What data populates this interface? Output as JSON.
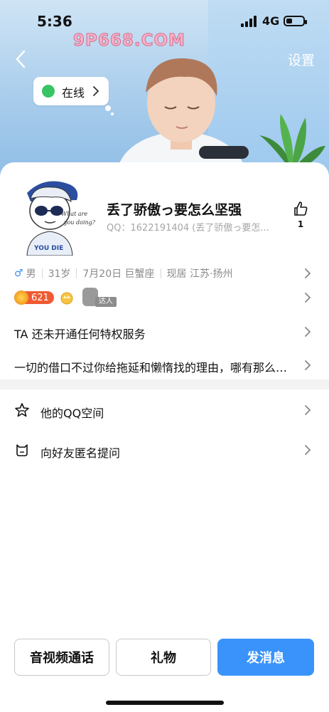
{
  "status_bar": {
    "time": "5:36",
    "network": "4G"
  },
  "header": {
    "watermark": "9P668.COM",
    "settings_label": "设置",
    "online_status": "在线"
  },
  "profile": {
    "nickname": "丢了骄傲っ要怎么坚强",
    "qq_line": "QQ：1622191404 (丢了骄傲っ要怎...",
    "like_count": "1",
    "gender": "男",
    "age": "31岁",
    "birthday": "7月20日 巨蟹座",
    "location": "现居 江苏·扬州",
    "level": "621",
    "talent_tag": "达人"
  },
  "lines": {
    "privilege": "TA 还未开通任何特权服务",
    "signature": "一切的借口不过你给拖延和懒惰找的理由，哪有那么多的借口"
  },
  "menu": {
    "qzone": "他的QQ空间",
    "anon_ask": "向好友匿名提问"
  },
  "actions": {
    "call": "音视频通话",
    "gift": "礼物",
    "message": "发消息"
  },
  "colors": {
    "accent": "#3a93fb",
    "online": "#39c463",
    "level_badge": "#ef5a32"
  }
}
